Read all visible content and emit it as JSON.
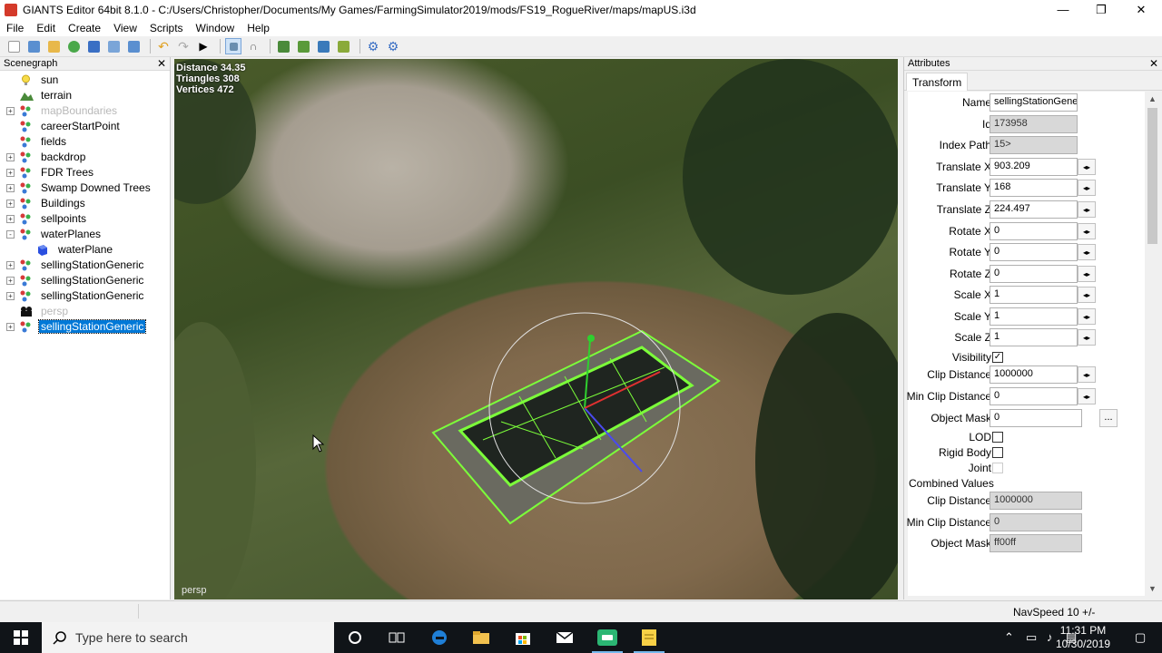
{
  "window": {
    "title": "GIANTS Editor 64bit 8.1.0 - C:/Users/Christopher/Documents/My Games/FarmingSimulator2019/mods/FS19_RogueRiver/maps/mapUS.i3d",
    "min_glyph": "—",
    "max_glyph": "❐",
    "close_glyph": "✕"
  },
  "menu": [
    "File",
    "Edit",
    "Create",
    "View",
    "Scripts",
    "Window",
    "Help"
  ],
  "scenegraph": {
    "title": "Scenegraph",
    "close_glyph": "✕",
    "nodes": [
      {
        "label": "sun",
        "icon": "light-bulb-icon",
        "expander": "",
        "dim": false,
        "selected": false
      },
      {
        "label": "terrain",
        "icon": "terrain-icon",
        "expander": "",
        "dim": false,
        "selected": false
      },
      {
        "label": "mapBoundaries",
        "icon": "transform-group-icon",
        "expander": "+",
        "dim": true,
        "selected": false
      },
      {
        "label": "careerStartPoint",
        "icon": "transform-group-icon",
        "expander": "",
        "dim": false,
        "selected": false
      },
      {
        "label": "fields",
        "icon": "transform-group-icon",
        "expander": "",
        "dim": false,
        "selected": false
      },
      {
        "label": "backdrop",
        "icon": "transform-group-icon",
        "expander": "+",
        "dim": false,
        "selected": false
      },
      {
        "label": "FDR Trees",
        "icon": "transform-group-icon",
        "expander": "+",
        "dim": false,
        "selected": false
      },
      {
        "label": "Swamp Downed Trees",
        "icon": "transform-group-icon",
        "expander": "+",
        "dim": false,
        "selected": false
      },
      {
        "label": "Buildings",
        "icon": "transform-group-icon",
        "expander": "+",
        "dim": false,
        "selected": false
      },
      {
        "label": "sellpoints",
        "icon": "transform-group-icon",
        "expander": "+",
        "dim": false,
        "selected": false
      },
      {
        "label": "waterPlanes",
        "icon": "transform-group-icon",
        "expander": "-",
        "dim": false,
        "selected": false
      },
      {
        "label": "waterPlane",
        "icon": "shape-cube-icon",
        "expander": "",
        "dim": false,
        "selected": false,
        "child": true
      },
      {
        "label": "sellingStationGeneric",
        "icon": "transform-group-icon",
        "expander": "+",
        "dim": false,
        "selected": false
      },
      {
        "label": "sellingStationGeneric",
        "icon": "transform-group-icon",
        "expander": "+",
        "dim": false,
        "selected": false
      },
      {
        "label": "sellingStationGeneric",
        "icon": "transform-group-icon",
        "expander": "+",
        "dim": false,
        "selected": false
      },
      {
        "label": "persp",
        "icon": "camera-icon",
        "expander": "",
        "dim": true,
        "selected": false
      },
      {
        "label": "sellingStationGeneric",
        "icon": "transform-group-icon",
        "expander": "+",
        "dim": false,
        "selected": true
      }
    ]
  },
  "viewport": {
    "stats": [
      "Distance 34.35",
      "Triangles 308",
      "Vertices 472"
    ],
    "camera": "persp"
  },
  "attributes": {
    "title": "Attributes",
    "close_glyph": "✕",
    "tab": "Transform",
    "name_label": "Name",
    "name_value": "sellingStationGeneric",
    "id_label": "Id",
    "id_value": "173958",
    "index_path_label": "Index Path",
    "index_path_value": "15>",
    "tx_label": "Translate X",
    "tx_value": "903.209",
    "ty_label": "Translate Y",
    "ty_value": "168",
    "tz_label": "Translate Z",
    "tz_value": "224.497",
    "rx_label": "Rotate X",
    "rx_value": "0",
    "ry_label": "Rotate Y",
    "ry_value": "0",
    "rz_label": "Rotate Z",
    "rz_value": "0",
    "sx_label": "Scale X",
    "sx_value": "1",
    "sy_label": "Scale Y",
    "sy_value": "1",
    "sz_label": "Scale Z",
    "sz_value": "1",
    "visibility_label": "Visibility",
    "visibility_checked": true,
    "clip_label": "Clip Distance",
    "clip_value": "1000000",
    "minclip_label": "Min Clip Distance",
    "minclip_value": "0",
    "objmask_label": "Object Mask",
    "objmask_value": "0",
    "dots": "...",
    "lod_label": "LOD",
    "rigid_label": "Rigid Body",
    "joint_label": "Joint",
    "combined_label": "Combined Values",
    "c_clip_label": "Clip Distance",
    "c_clip_value": "1000000",
    "c_minclip_label": "Min Clip Distance",
    "c_minclip_value": "0",
    "c_objmask_label": "Object Mask",
    "c_objmask_value": "ff00ff",
    "spin_glyph": "◂▸",
    "check_glyph": "✓"
  },
  "statusbar": {
    "navspeed": "NavSpeed 10 +/-"
  },
  "taskbar": {
    "search_placeholder": "Type here to search",
    "time": "11:31 PM",
    "date": "10/30/2019",
    "apps": [
      "cortana-icon",
      "task-view-icon",
      "edge-icon",
      "file-explorer-icon",
      "store-icon",
      "mail-icon",
      "giants-editor-icon",
      "sticky-notes-icon"
    ]
  }
}
